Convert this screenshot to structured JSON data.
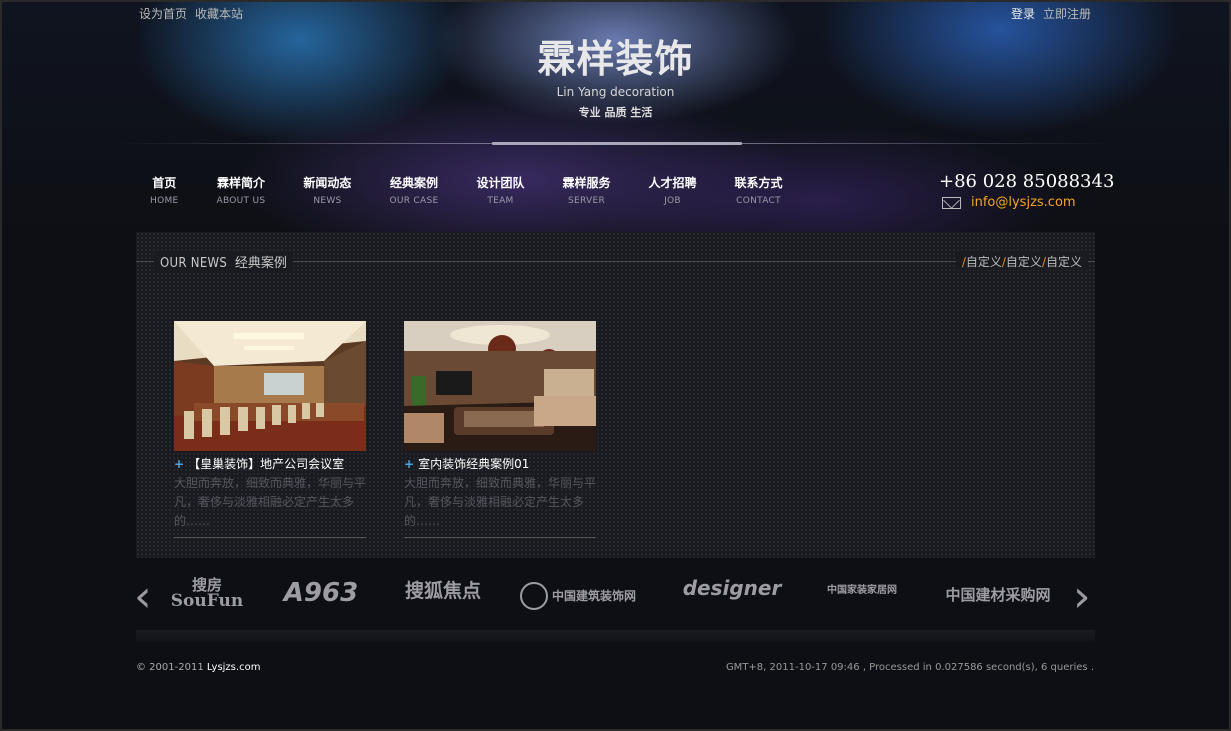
{
  "top_bar": {
    "left_links": [
      "设为首页",
      "收藏本站"
    ],
    "login": "登录",
    "register": "立即注册"
  },
  "brand": {
    "name": "霖样装饰",
    "english": "Lin Yang decoration",
    "slogan": "专业 品质 生活"
  },
  "nav": [
    {
      "cn": "首页",
      "en": "HOME"
    },
    {
      "cn": "霖样简介",
      "en": "ABOUT US"
    },
    {
      "cn": "新闻动态",
      "en": "NEWS"
    },
    {
      "cn": "经典案例",
      "en": "OUR CASE"
    },
    {
      "cn": "设计团队",
      "en": "TEAM"
    },
    {
      "cn": "霖样服务",
      "en": "SERVER"
    },
    {
      "cn": "人才招聘",
      "en": "JOB"
    },
    {
      "cn": "联系方式",
      "en": "CONTACT"
    }
  ],
  "contact": {
    "phone": "+86 028 85088343",
    "email": "info@lysjzs.com"
  },
  "section": {
    "title_en": "OUR  NEWS",
    "title_cn": "经典案例",
    "links": [
      "自定义",
      "自定义",
      "自定义"
    ]
  },
  "cases": [
    {
      "title": "【皇巢装饰】地产公司会议室",
      "description": "大胆而奔放，细致而典雅，华丽与平凡，奢侈与淡雅相融必定产生太多的……"
    },
    {
      "title": "室内装饰经典案例01",
      "description": "大胆而奔放，细致而典雅，华丽与平凡，奢侈与淡雅相融必定产生太多的……"
    }
  ],
  "partners": [
    {
      "name": "搜房",
      "sub": "SouFun"
    },
    {
      "name": "A963",
      "sub": ""
    },
    {
      "name": "搜狐焦点",
      "sub": ""
    },
    {
      "name": "中国建筑装饰网",
      "sub": ""
    },
    {
      "name": "designer",
      "sub": ""
    },
    {
      "name": "中国家装家居网",
      "sub": ""
    },
    {
      "name": "中国建材采购网",
      "sub": ""
    }
  ],
  "footer": {
    "copyright": "© 2001-2011",
    "site": "Lysjzs.com",
    "stats": "GMT+8, 2011-10-17 09:46 , Processed in 0.027586 second(s), 6 queries ."
  }
}
